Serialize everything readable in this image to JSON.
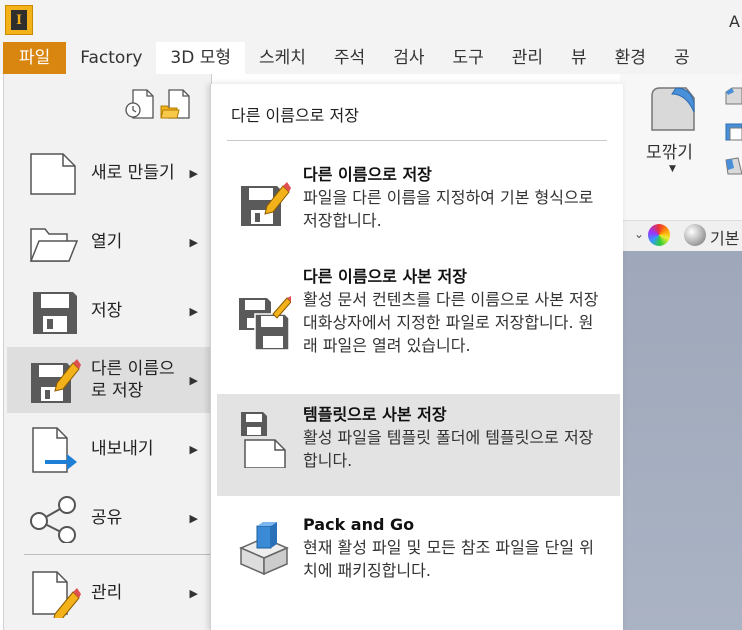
{
  "app": {
    "logo_letter": "I",
    "title_fragment": "A"
  },
  "menubar": {
    "tabs": [
      {
        "label": "파일"
      },
      {
        "label": "Factory"
      },
      {
        "label": "3D 모형"
      },
      {
        "label": "스케치"
      },
      {
        "label": "주석"
      },
      {
        "label": "검사"
      },
      {
        "label": "도구"
      },
      {
        "label": "관리"
      },
      {
        "label": "뷰"
      },
      {
        "label": "환경"
      },
      {
        "label": "공"
      }
    ]
  },
  "ribbon": {
    "chamfer_label": "모깎기",
    "material_label": "기본"
  },
  "file_menu": {
    "quick_access_icons": [
      "recent-documents-icon",
      "open-folder-icon"
    ],
    "items": [
      {
        "label": "새로 만들기",
        "icon": "new-document-icon"
      },
      {
        "label": "열기",
        "icon": "open-folder-icon"
      },
      {
        "label": "저장",
        "icon": "save-icon"
      },
      {
        "label": "다른 이름으로 저장",
        "icon": "save-as-icon"
      },
      {
        "label": "내보내기",
        "icon": "export-icon"
      },
      {
        "label": "공유",
        "icon": "share-icon"
      },
      {
        "label": "관리",
        "icon": "manage-icon"
      }
    ]
  },
  "submenu": {
    "title": "다른 이름으로 저장",
    "items": [
      {
        "name": "다른 이름으로 저장",
        "desc": "파일을 다른 이름을 지정하여 기본 형식으로 저장합니다."
      },
      {
        "name": "다른 이름으로 사본 저장",
        "desc": "활성 문서 컨텐츠를 다른 이름으로 사본 저장 대화상자에서 지정한 파일로 저장합니다. 원래 파일은 열려 있습니다."
      },
      {
        "name": "템플릿으로 사본 저장",
        "desc": "활성 파일을 템플릿 폴더에 템플릿으로 저장합니다."
      },
      {
        "name": "Pack and Go",
        "desc": "현재 활성 파일 및 모든 참조 파일을 단일 위치에 패키징합니다."
      }
    ]
  }
}
